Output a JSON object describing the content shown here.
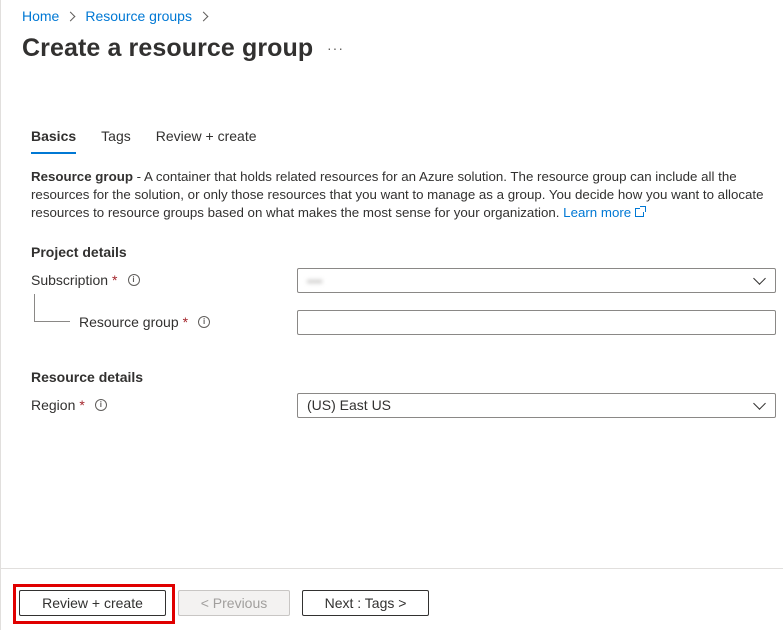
{
  "breadcrumb": {
    "items": [
      "Home",
      "Resource groups"
    ]
  },
  "page": {
    "title": "Create a resource group",
    "more_label": "···"
  },
  "tabs": [
    {
      "label": "Basics",
      "active": true
    },
    {
      "label": "Tags",
      "active": false
    },
    {
      "label": "Review + create",
      "active": false
    }
  ],
  "description": {
    "term": "Resource group",
    "text": " - A container that holds related resources for an Azure solution. The resource group can include all the resources for the solution, or only those resources that you want to manage as a group. You decide how you want to allocate resources to resource groups based on what makes the most sense for your organization.",
    "link": "Learn more"
  },
  "project_details": {
    "heading": "Project details",
    "subscription": {
      "label": "Subscription",
      "required": "*",
      "value": "••••"
    },
    "resource_group": {
      "label": "Resource group",
      "required": "*",
      "value": ""
    }
  },
  "resource_details": {
    "heading": "Resource details",
    "region": {
      "label": "Region",
      "required": "*",
      "value": "(US) East US"
    }
  },
  "footer": {
    "review_create": "Review + create",
    "previous": "< Previous",
    "next": "Next : Tags >"
  },
  "colors": {
    "accent": "#0078d4",
    "required": "#a4262c",
    "highlight": "#e00000"
  }
}
